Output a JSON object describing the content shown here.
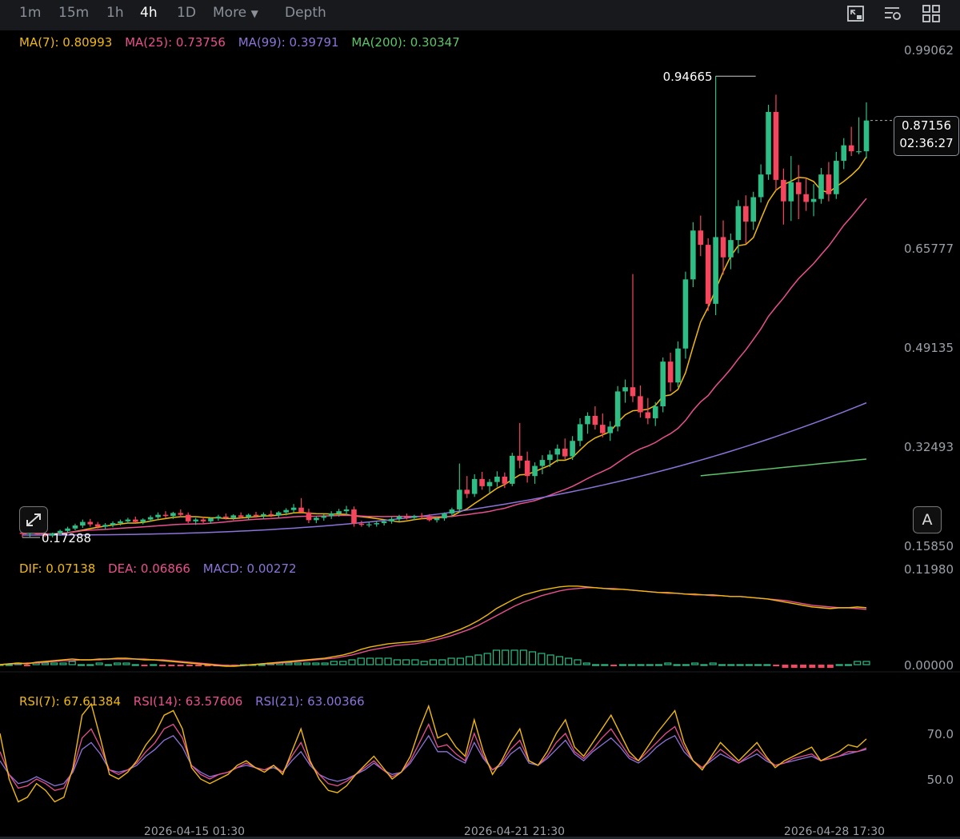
{
  "toolbar": {
    "timeframes": [
      "1m",
      "15m",
      "1h",
      "4h",
      "1D"
    ],
    "active": "4h",
    "more_label": "More",
    "depth_label": "Depth",
    "icons": [
      "chart-screenshot-icon",
      "chart-settings-icon",
      "grid-layout-icon"
    ]
  },
  "legend": {
    "ma": [
      {
        "label": "MA(7): 0.80993",
        "color": "#f0b90b"
      },
      {
        "label": "MA(25): 0.73756",
        "color": "#e8508e"
      },
      {
        "label": "MA(99): 0.39791",
        "color": "#8c73d9"
      },
      {
        "label": "MA(200): 0.30347",
        "color": "#5cc46a"
      }
    ],
    "macd": [
      {
        "label": "DIF: 0.07138",
        "color": "#f0b90b"
      },
      {
        "label": "DEA: 0.06866",
        "color": "#e8508e"
      },
      {
        "label": "MACD: 0.00272",
        "color": "#8c73d9"
      }
    ],
    "rsi": [
      {
        "label": "RSI(7): 67.61384",
        "color": "#f0b90b"
      },
      {
        "label": "RSI(14): 63.57606",
        "color": "#e8508e"
      },
      {
        "label": "RSI(21): 63.00366",
        "color": "#8c73d9"
      }
    ]
  },
  "price_box": {
    "price": "0.87156",
    "countdown": "02:36:27"
  },
  "auto_label": "A",
  "annotations": {
    "high": "0.94665",
    "low": "0.17288"
  },
  "colors": {
    "up": "#2ebd85",
    "down": "#f6465d"
  },
  "chart_data": [
    {
      "type": "candlestick",
      "title": "",
      "y_ticks": [
        "0.99062",
        "0.65777",
        "0.49135",
        "0.32493",
        "0.15850"
      ],
      "x_ticks": [
        "2026-04-15 01:30",
        "2026-04-21 21:30",
        "2026-04-28 17:30"
      ],
      "ylim": [
        0.1585,
        0.99062
      ],
      "candles": [
        [
          0.18,
          0.185,
          0.172,
          0.178
        ],
        [
          0.178,
          0.183,
          0.173,
          0.181
        ],
        [
          0.181,
          0.186,
          0.176,
          0.177
        ],
        [
          0.177,
          0.182,
          0.1729,
          0.175
        ],
        [
          0.175,
          0.18,
          0.172,
          0.179
        ],
        [
          0.179,
          0.185,
          0.175,
          0.183
        ],
        [
          0.183,
          0.19,
          0.18,
          0.187
        ],
        [
          0.187,
          0.195,
          0.184,
          0.192
        ],
        [
          0.192,
          0.202,
          0.188,
          0.198
        ],
        [
          0.198,
          0.203,
          0.19,
          0.194
        ],
        [
          0.194,
          0.198,
          0.187,
          0.19
        ],
        [
          0.19,
          0.196,
          0.186,
          0.193
        ],
        [
          0.193,
          0.199,
          0.189,
          0.196
        ],
        [
          0.196,
          0.202,
          0.192,
          0.199
        ],
        [
          0.199,
          0.205,
          0.195,
          0.202
        ],
        [
          0.202,
          0.207,
          0.196,
          0.198
        ],
        [
          0.198,
          0.204,
          0.194,
          0.202
        ],
        [
          0.202,
          0.209,
          0.198,
          0.206
        ],
        [
          0.206,
          0.214,
          0.202,
          0.21
        ],
        [
          0.21,
          0.216,
          0.205,
          0.208
        ],
        [
          0.208,
          0.215,
          0.203,
          0.213
        ],
        [
          0.213,
          0.219,
          0.206,
          0.21
        ],
        [
          0.21,
          0.214,
          0.196,
          0.199
        ],
        [
          0.199,
          0.205,
          0.193,
          0.202
        ],
        [
          0.202,
          0.207,
          0.196,
          0.199
        ],
        [
          0.199,
          0.206,
          0.195,
          0.204
        ],
        [
          0.204,
          0.21,
          0.2,
          0.207
        ],
        [
          0.207,
          0.212,
          0.202,
          0.205
        ],
        [
          0.205,
          0.211,
          0.201,
          0.209
        ],
        [
          0.209,
          0.214,
          0.204,
          0.206
        ],
        [
          0.206,
          0.212,
          0.202,
          0.21
        ],
        [
          0.21,
          0.215,
          0.205,
          0.208
        ],
        [
          0.208,
          0.214,
          0.203,
          0.211
        ],
        [
          0.211,
          0.217,
          0.206,
          0.209
        ],
        [
          0.209,
          0.216,
          0.205,
          0.214
        ],
        [
          0.214,
          0.221,
          0.209,
          0.218
        ],
        [
          0.218,
          0.228,
          0.213,
          0.222
        ],
        [
          0.222,
          0.238,
          0.215,
          0.214
        ],
        [
          0.214,
          0.22,
          0.196,
          0.201
        ],
        [
          0.201,
          0.208,
          0.196,
          0.205
        ],
        [
          0.205,
          0.211,
          0.2,
          0.208
        ],
        [
          0.208,
          0.216,
          0.203,
          0.212
        ],
        [
          0.212,
          0.22,
          0.207,
          0.216
        ],
        [
          0.216,
          0.225,
          0.21,
          0.219
        ],
        [
          0.219,
          0.224,
          0.19,
          0.195
        ],
        [
          0.195,
          0.2,
          0.19,
          0.193
        ],
        [
          0.193,
          0.198,
          0.189,
          0.194
        ],
        [
          0.194,
          0.199,
          0.19,
          0.196
        ],
        [
          0.196,
          0.202,
          0.192,
          0.199
        ],
        [
          0.199,
          0.206,
          0.195,
          0.203
        ],
        [
          0.203,
          0.21,
          0.199,
          0.207
        ],
        [
          0.207,
          0.212,
          0.202,
          0.205
        ],
        [
          0.205,
          0.21,
          0.201,
          0.208
        ],
        [
          0.208,
          0.213,
          0.203,
          0.206
        ],
        [
          0.206,
          0.211,
          0.199,
          0.201
        ],
        [
          0.201,
          0.206,
          0.197,
          0.204
        ],
        [
          0.204,
          0.214,
          0.2,
          0.212
        ],
        [
          0.212,
          0.222,
          0.208,
          0.219
        ],
        [
          0.219,
          0.296,
          0.214,
          0.252
        ],
        [
          0.252,
          0.275,
          0.238,
          0.245
        ],
        [
          0.245,
          0.278,
          0.24,
          0.27
        ],
        [
          0.27,
          0.282,
          0.252,
          0.258
        ],
        [
          0.258,
          0.27,
          0.247,
          0.265
        ],
        [
          0.265,
          0.283,
          0.257,
          0.274
        ],
        [
          0.274,
          0.281,
          0.255,
          0.262
        ],
        [
          0.262,
          0.314,
          0.258,
          0.309
        ],
        [
          0.309,
          0.364,
          0.288,
          0.301
        ],
        [
          0.301,
          0.316,
          0.264,
          0.275
        ],
        [
          0.275,
          0.298,
          0.262,
          0.292
        ],
        [
          0.292,
          0.31,
          0.278,
          0.302
        ],
        [
          0.302,
          0.318,
          0.29,
          0.311
        ],
        [
          0.311,
          0.328,
          0.298,
          0.321
        ],
        [
          0.321,
          0.338,
          0.303,
          0.308
        ],
        [
          0.308,
          0.342,
          0.302,
          0.334
        ],
        [
          0.334,
          0.372,
          0.325,
          0.362
        ],
        [
          0.362,
          0.382,
          0.346,
          0.376
        ],
        [
          0.376,
          0.392,
          0.353,
          0.361
        ],
        [
          0.361,
          0.38,
          0.34,
          0.347
        ],
        [
          0.347,
          0.367,
          0.334,
          0.358
        ],
        [
          0.358,
          0.426,
          0.35,
          0.417
        ],
        [
          0.417,
          0.437,
          0.398,
          0.424
        ],
        [
          0.424,
          0.614,
          0.399,
          0.409
        ],
        [
          0.409,
          0.427,
          0.373,
          0.382
        ],
        [
          0.382,
          0.406,
          0.362,
          0.372
        ],
        [
          0.372,
          0.399,
          0.359,
          0.392
        ],
        [
          0.392,
          0.474,
          0.382,
          0.467
        ],
        [
          0.467,
          0.482,
          0.417,
          0.432
        ],
        [
          0.432,
          0.501,
          0.424,
          0.489
        ],
        [
          0.489,
          0.618,
          0.472,
          0.605
        ],
        [
          0.605,
          0.701,
          0.592,
          0.687
        ],
        [
          0.687,
          0.712,
          0.644,
          0.663
        ],
        [
          0.663,
          0.674,
          0.552,
          0.564
        ],
        [
          0.564,
          0.946,
          0.545,
          0.676
        ],
        [
          0.676,
          0.704,
          0.613,
          0.642
        ],
        [
          0.642,
          0.682,
          0.622,
          0.671
        ],
        [
          0.671,
          0.738,
          0.649,
          0.728
        ],
        [
          0.728,
          0.746,
          0.665,
          0.702
        ],
        [
          0.702,
          0.752,
          0.688,
          0.743
        ],
        [
          0.743,
          0.798,
          0.734,
          0.781
        ],
        [
          0.781,
          0.898,
          0.772,
          0.886
        ],
        [
          0.886,
          0.915,
          0.754,
          0.772
        ],
        [
          0.772,
          0.791,
          0.697,
          0.736
        ],
        [
          0.736,
          0.812,
          0.703,
          0.768
        ],
        [
          0.768,
          0.797,
          0.706,
          0.748
        ],
        [
          0.748,
          0.775,
          0.72,
          0.735
        ],
        [
          0.735,
          0.765,
          0.711,
          0.74
        ],
        [
          0.74,
          0.792,
          0.732,
          0.781
        ],
        [
          0.781,
          0.802,
          0.736,
          0.748
        ],
        [
          0.748,
          0.819,
          0.74,
          0.804
        ],
        [
          0.804,
          0.842,
          0.79,
          0.83
        ],
        [
          0.83,
          0.861,
          0.812,
          0.82
        ],
        [
          0.82,
          0.877,
          0.815,
          0.82
        ],
        [
          0.82,
          0.902,
          0.808,
          0.8716
        ]
      ],
      "ma_series": [
        {
          "name": "MA(7)",
          "last": 0.80993
        },
        {
          "name": "MA(25)",
          "last": 0.73756
        },
        {
          "name": "MA(99)",
          "last": 0.39791
        },
        {
          "name": "MA(200)",
          "last": 0.30347
        }
      ]
    },
    {
      "type": "bar+line",
      "title": "",
      "y_ticks": [
        "0.11980",
        "0.00000"
      ],
      "ylim": [
        -0.012,
        0.1198
      ],
      "dif": [
        0.0,
        0.001,
        0.002,
        0.001,
        0.003,
        0.004,
        0.005,
        0.006,
        0.007,
        0.006,
        0.006,
        0.007,
        0.007,
        0.008,
        0.008,
        0.007,
        0.006,
        0.006,
        0.005,
        0.004,
        0.003,
        0.002,
        0.001,
        0.0,
        -0.001,
        -0.002,
        -0.002,
        -0.001,
        0.0,
        0.001,
        0.002,
        0.003,
        0.004,
        0.005,
        0.006,
        0.007,
        0.008,
        0.01,
        0.012,
        0.015,
        0.019,
        0.022,
        0.024,
        0.026,
        0.027,
        0.028,
        0.029,
        0.03,
        0.033,
        0.036,
        0.04,
        0.044,
        0.049,
        0.055,
        0.062,
        0.07,
        0.076,
        0.082,
        0.087,
        0.09,
        0.093,
        0.095,
        0.097,
        0.098,
        0.098,
        0.097,
        0.096,
        0.095,
        0.094,
        0.094,
        0.093,
        0.092,
        0.091,
        0.09,
        0.09,
        0.089,
        0.088,
        0.088,
        0.087,
        0.087,
        0.086,
        0.085,
        0.085,
        0.084,
        0.083,
        0.082,
        0.08,
        0.078,
        0.076,
        0.074,
        0.072,
        0.071,
        0.07,
        0.071,
        0.071,
        0.072,
        0.071
      ],
      "dea": [
        0.0,
        0.001,
        0.001,
        0.002,
        0.002,
        0.003,
        0.004,
        0.005,
        0.005,
        0.006,
        0.006,
        0.006,
        0.007,
        0.007,
        0.007,
        0.007,
        0.007,
        0.006,
        0.006,
        0.005,
        0.004,
        0.003,
        0.002,
        0.001,
        0.0,
        -0.001,
        -0.001,
        -0.001,
        0.0,
        0.001,
        0.001,
        0.002,
        0.003,
        0.004,
        0.005,
        0.006,
        0.007,
        0.008,
        0.01,
        0.012,
        0.015,
        0.018,
        0.02,
        0.022,
        0.024,
        0.025,
        0.026,
        0.028,
        0.03,
        0.033,
        0.036,
        0.04,
        0.044,
        0.049,
        0.055,
        0.061,
        0.067,
        0.073,
        0.078,
        0.082,
        0.086,
        0.089,
        0.092,
        0.094,
        0.095,
        0.096,
        0.096,
        0.095,
        0.095,
        0.094,
        0.093,
        0.092,
        0.091,
        0.09,
        0.089,
        0.089,
        0.088,
        0.087,
        0.087,
        0.086,
        0.086,
        0.085,
        0.085,
        0.084,
        0.083,
        0.082,
        0.081,
        0.08,
        0.078,
        0.076,
        0.074,
        0.073,
        0.072,
        0.071,
        0.071,
        0.07,
        0.069
      ],
      "last": {
        "DIF": 0.07138,
        "DEA": 0.06866,
        "MACD": 0.00272
      }
    },
    {
      "type": "line",
      "title": "",
      "y_ticks": [
        "70.0",
        "50.0"
      ],
      "ylim": [
        30,
        92
      ],
      "rsi7": [
        70,
        50,
        40,
        42,
        48,
        45,
        40,
        42,
        55,
        78,
        83,
        68,
        52,
        50,
        53,
        58,
        65,
        70,
        78,
        80,
        72,
        55,
        50,
        48,
        50,
        52,
        56,
        58,
        55,
        53,
        56,
        52,
        62,
        72,
        58,
        50,
        45,
        44,
        47,
        52,
        56,
        60,
        55,
        50,
        53,
        60,
        72,
        82,
        68,
        70,
        64,
        60,
        76,
        62,
        52,
        58,
        66,
        72,
        58,
        56,
        62,
        70,
        76,
        64,
        60,
        66,
        72,
        78,
        70,
        62,
        58,
        64,
        70,
        75,
        80,
        66,
        58,
        54,
        60,
        66,
        62,
        58,
        62,
        66,
        60,
        55,
        58,
        60,
        62,
        64,
        58,
        60,
        62,
        65,
        64,
        67.6
      ],
      "rsi14": [
        62,
        52,
        46,
        47,
        50,
        48,
        45,
        46,
        54,
        68,
        72,
        64,
        54,
        52,
        54,
        57,
        62,
        66,
        72,
        74,
        68,
        56,
        52,
        50,
        52,
        53,
        55,
        57,
        55,
        54,
        56,
        53,
        60,
        66,
        57,
        52,
        48,
        47,
        49,
        52,
        55,
        58,
        54,
        51,
        53,
        58,
        66,
        74,
        64,
        65,
        61,
        58,
        70,
        60,
        54,
        57,
        63,
        67,
        58,
        56,
        60,
        66,
        70,
        62,
        59,
        63,
        68,
        72,
        66,
        60,
        58,
        62,
        66,
        70,
        73,
        64,
        58,
        55,
        59,
        63,
        60,
        57,
        60,
        63,
        59,
        56,
        57,
        59,
        60,
        61,
        58,
        59,
        60,
        62,
        62,
        63.6
      ],
      "rsi21": [
        58,
        52,
        48,
        49,
        51,
        49,
        47,
        48,
        53,
        63,
        66,
        61,
        54,
        53,
        54,
        56,
        60,
        63,
        67,
        69,
        64,
        56,
        53,
        51,
        52,
        53,
        55,
        56,
        55,
        54,
        55,
        53,
        58,
        62,
        56,
        52,
        50,
        49,
        50,
        52,
        54,
        57,
        54,
        52,
        53,
        57,
        63,
        69,
        62,
        62,
        59,
        57,
        66,
        59,
        54,
        56,
        61,
        64,
        57,
        56,
        59,
        63,
        67,
        61,
        58,
        62,
        65,
        68,
        64,
        59,
        57,
        60,
        64,
        67,
        69,
        62,
        58,
        55,
        58,
        61,
        59,
        57,
        59,
        61,
        58,
        56,
        57,
        58,
        59,
        60,
        58,
        59,
        60,
        61,
        62,
        63.0
      ],
      "last": {
        "RSI(7)": 67.61384,
        "RSI(14)": 63.57606,
        "RSI(21)": 63.00366
      }
    }
  ]
}
